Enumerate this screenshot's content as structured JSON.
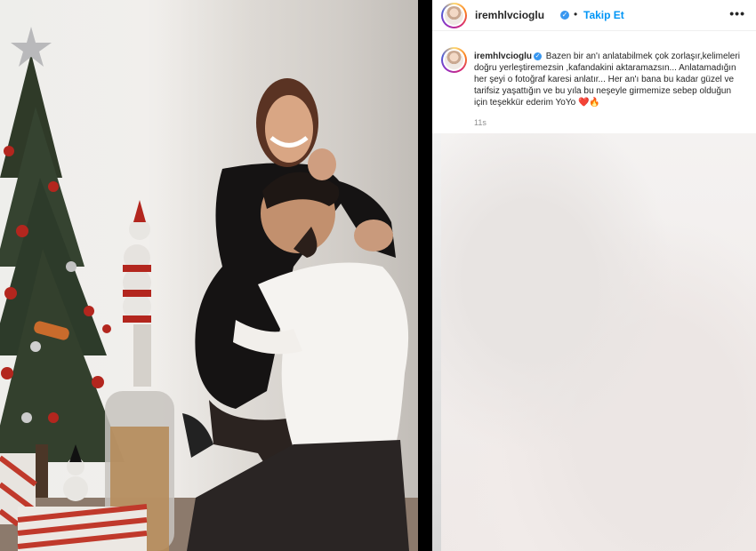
{
  "post": {
    "username": "iremhlvcioglu",
    "follow_label": "Takip Et",
    "dot": "•",
    "more_label": "•••",
    "caption_username": "iremhlvcioglu",
    "caption_text": "Bazen bir an'ı anlatabilmek çok zorlaşır,kelimeleri doğru yerleştiremezsin ,kafandakini aktaramazsın... Anlatamadığın her şeyi o fotoğraf karesi anlatır... Her an'ı bana bu kadar güzel ve tarifsiz yaşattığın ve bu yıla bu neşeyle girmemize sebep olduğun için teşekkür ederim YoYo",
    "caption_emoji": "❤️🔥",
    "time": "11s",
    "verified_mark": "✓"
  },
  "colors": {
    "accent": "#0095f6",
    "verified": "#3897f0",
    "text": "#262626",
    "muted": "#8e8e8e"
  },
  "icons": {
    "avatar": "avatar-icon",
    "verified": "verified-badge-icon",
    "more": "more-options-icon"
  }
}
